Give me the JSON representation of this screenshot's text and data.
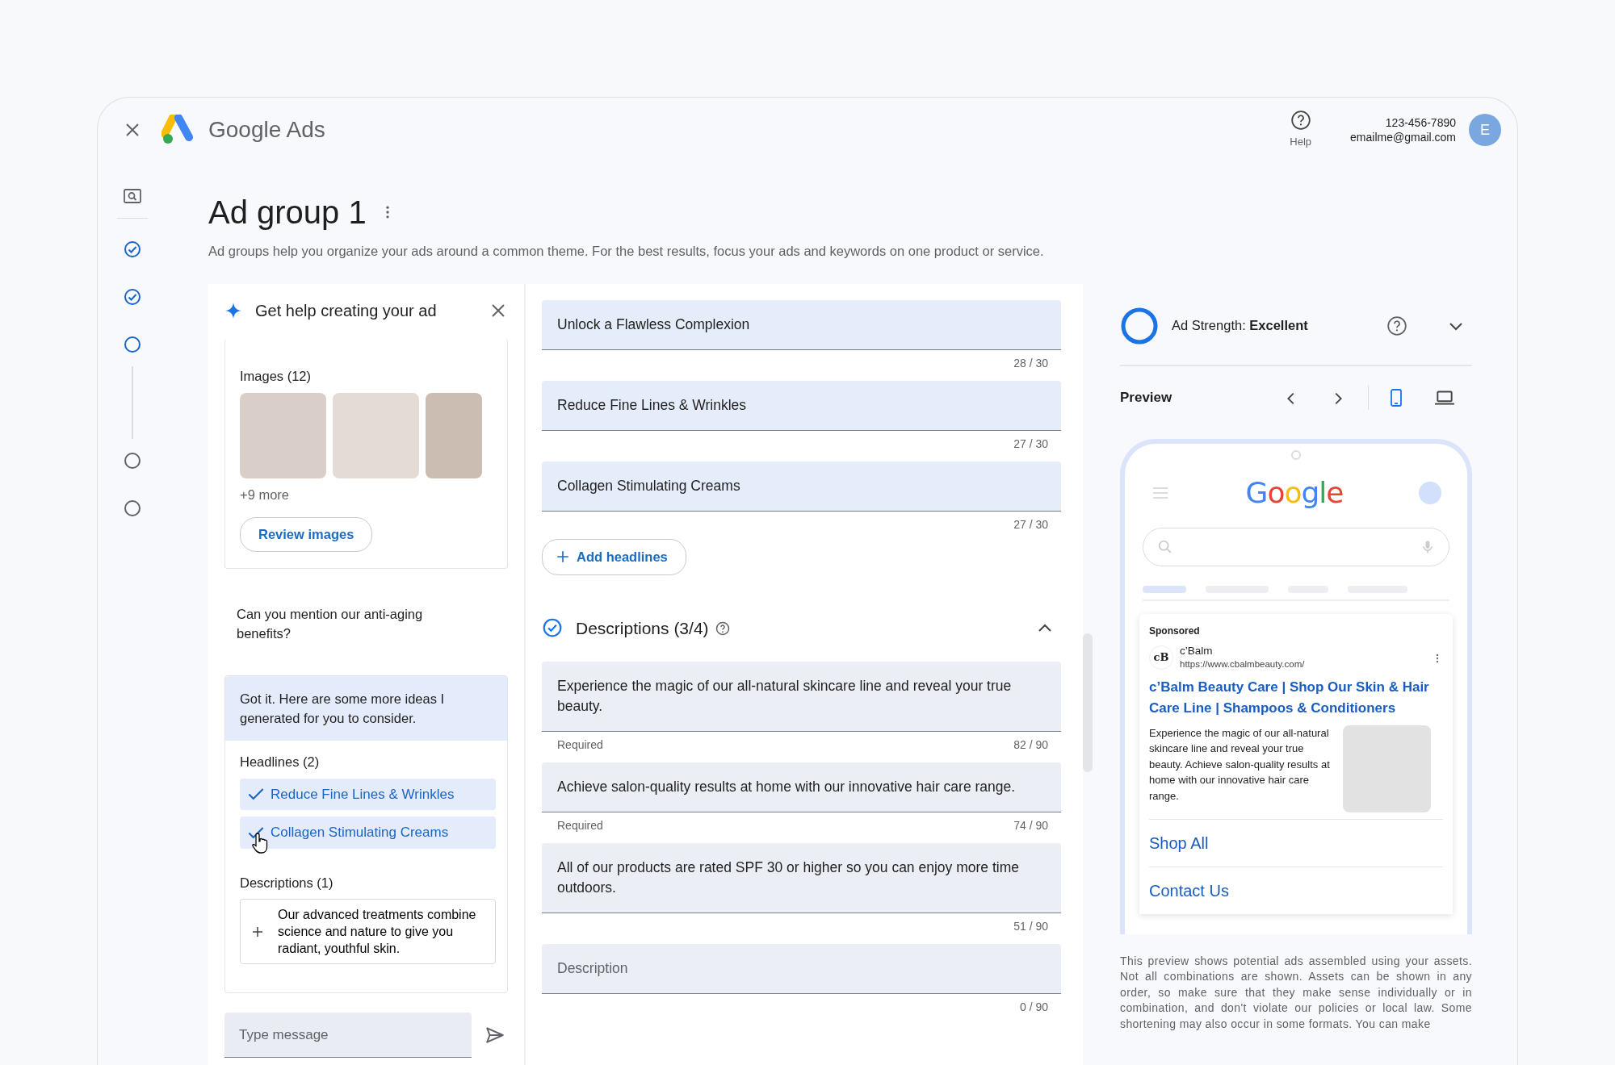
{
  "app": {
    "brand": "Google",
    "product": "Ads"
  },
  "header": {
    "help_label": "Help",
    "phone": "123-456-7890",
    "email": "emailme@gmail.com",
    "avatar_initial": "E"
  },
  "steps": [
    {
      "kind": "review"
    },
    {
      "kind": "done"
    },
    {
      "kind": "done"
    },
    {
      "kind": "current"
    },
    {
      "kind": "pending"
    },
    {
      "kind": "pending"
    }
  ],
  "page": {
    "title": "Ad group 1",
    "subtitle": "Ad groups help you organize your ads around a common theme. For the best results, focus your ads and keywords on one product or service."
  },
  "assistant": {
    "title": "Get help creating your ad",
    "images_label": "Images (12)",
    "images_more": "+9 more",
    "review_button": "Review images",
    "user_message": "Can you mention our anti-aging benefits?",
    "reply": {
      "text": "Got it. Here are some more ideas I generated for you to consider.",
      "headlines_label": "Headlines (2)",
      "headlines": [
        {
          "text": "Reduce Fine Lines & Wrinkles",
          "checked": true
        },
        {
          "text": "Collagen Stimulating Creams",
          "checked": true
        }
      ],
      "descriptions_label": "Descriptions (1)",
      "descriptions": [
        "Our advanced treatments combine science and nature to give you radiant, youthful skin."
      ]
    },
    "message_placeholder": "Type message"
  },
  "headlines": [
    {
      "value": "Unlock a Flawless Complexion",
      "counter": "28 / 30"
    },
    {
      "value": "Reduce Fine Lines & Wrinkles",
      "counter": "27 / 30"
    },
    {
      "value": "Collagen Stimulating Creams",
      "counter": "27 / 30"
    }
  ],
  "add_headlines": "Add headlines",
  "descriptions": {
    "title": "Descriptions (3/4)",
    "complete": true,
    "expanded": true,
    "fields": [
      {
        "value": "Experience the magic of our all-natural skincare line and reveal your true beauty.",
        "note": "Required",
        "counter": "82 / 90"
      },
      {
        "value": "Achieve salon-quality results at home with our innovative hair care range.",
        "note": "Required",
        "counter": "74 / 90"
      },
      {
        "value": "All of our products are rated SPF 30 or higher so you can enjoy more time outdoors.",
        "counter": "51 / 90"
      },
      {
        "placeholder": "Description",
        "counter": "0 / 90"
      }
    ]
  },
  "ad_strength": {
    "text": "Ad Strength: **Excellent**",
    "level": 1
  },
  "preview": {
    "title": "Preview",
    "devices": [
      {
        "kind": "mobile",
        "selected": true
      },
      {
        "kind": "desktop",
        "selected": false
      }
    ]
  },
  "mock": {
    "logo": "Google",
    "sponsored": "Sponsored",
    "logo_text": "cB",
    "advertiser": "c’Balm",
    "url": "https://www.cbalmbeauty.com/",
    "headline": "c’Balm Beauty Care | Shop Our Skin & Hair Care Line | Shampoos & Conditioners",
    "description": "Experience the magic of our all-natural skincare line and reveal your true beauty. Achieve salon-quality results at home with our innovative hair care range.",
    "sitelinks": [
      "Shop All",
      "Contact Us"
    ]
  },
  "disclaimer": "This preview shows potential ads assembled using your assets. Not all combinations are shown. Assets can be shown in any order, so make sure that they make sense individually or in combination, and don't violate our policies or local law. Some shortening may also occur in some formats. You can make"
}
